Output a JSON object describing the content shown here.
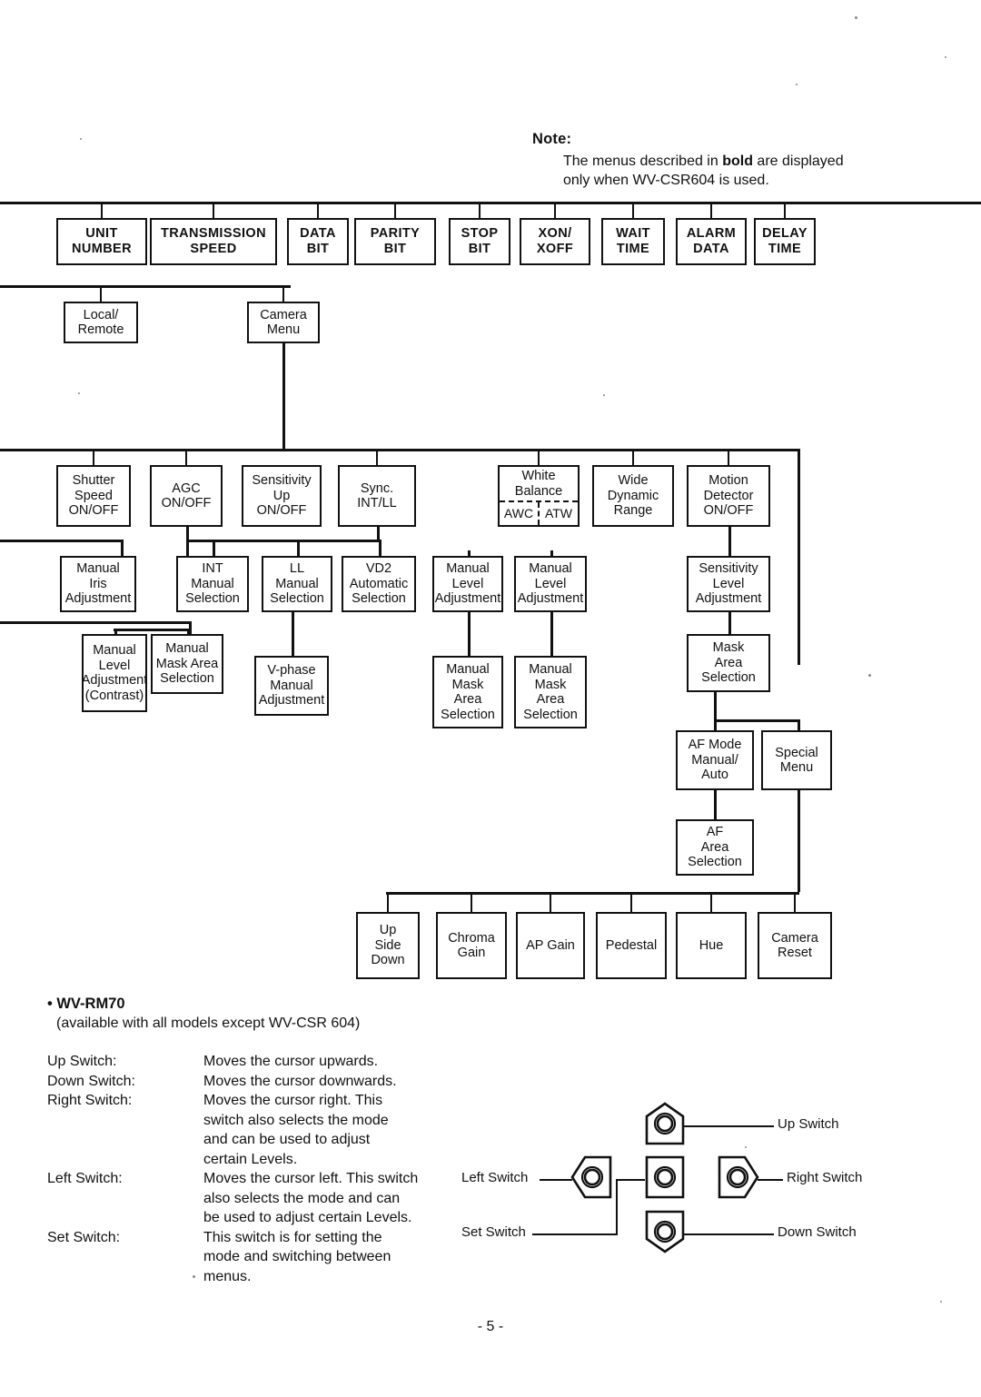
{
  "note": {
    "title": "Note:",
    "line1_pre": "The menus described in ",
    "line1_bold": "bold",
    "line1_post": " are displayed",
    "line2": "only when WV-CSR604 is used."
  },
  "chart": {
    "type": "diagram",
    "title": "Camera system menu hierarchy",
    "row_communication": [
      {
        "id": "unit-number",
        "lines": [
          "UNIT",
          "NUMBER"
        ],
        "bold": true
      },
      {
        "id": "transmission-speed",
        "lines": [
          "TRANSMISSION",
          "SPEED"
        ],
        "bold": true
      },
      {
        "id": "data-bit",
        "lines": [
          "DATA",
          "BIT"
        ],
        "bold": true
      },
      {
        "id": "parity-bit",
        "lines": [
          "PARITY",
          "BIT"
        ],
        "bold": true
      },
      {
        "id": "stop-bit",
        "lines": [
          "STOP",
          "BIT"
        ],
        "bold": true
      },
      {
        "id": "xon-xoff",
        "lines": [
          "XON/",
          "XOFF"
        ],
        "bold": true
      },
      {
        "id": "wait-time",
        "lines": [
          "WAIT",
          "TIME"
        ],
        "bold": true
      },
      {
        "id": "alarm-data",
        "lines": [
          "ALARM",
          "DATA"
        ],
        "bold": true
      },
      {
        "id": "delay-time",
        "lines": [
          "DELAY",
          "TIME"
        ],
        "bold": true
      }
    ],
    "row_mode": [
      {
        "id": "local-remote",
        "lines": [
          "Local/",
          "Remote"
        ]
      },
      {
        "id": "camera-menu",
        "lines": [
          "Camera",
          "Menu"
        ]
      }
    ],
    "row_camera_main": [
      {
        "id": "shutter-speed",
        "lines": [
          "Shutter",
          "Speed",
          "ON/OFF"
        ]
      },
      {
        "id": "agc",
        "lines": [
          "AGC",
          "ON/OFF"
        ]
      },
      {
        "id": "sensitivity-up",
        "lines": [
          "Sensitivity",
          "Up",
          "ON/OFF"
        ]
      },
      {
        "id": "sync",
        "lines": [
          "Sync.",
          "INT/LL"
        ]
      },
      {
        "id": "white-balance",
        "lines": [
          "White",
          "Balance"
        ],
        "split": [
          "AWC",
          "ATW"
        ]
      },
      {
        "id": "wide-dynamic-range",
        "lines": [
          "Wide",
          "Dynamic",
          "Range"
        ]
      },
      {
        "id": "motion-detector",
        "lines": [
          "Motion",
          "Detector",
          "ON/OFF"
        ]
      }
    ],
    "row_sub1": [
      {
        "id": "manual-iris-adjustment",
        "lines": [
          "Manual",
          "Iris",
          "Adjustment"
        ]
      },
      {
        "id": "int-manual-selection",
        "lines": [
          "INT",
          "Manual",
          "Selection"
        ]
      },
      {
        "id": "ll-manual-selection",
        "lines": [
          "LL",
          "Manual",
          "Selection"
        ]
      },
      {
        "id": "vd2-automatic-selection",
        "lines": [
          "VD2",
          "Automatic",
          "Selection"
        ]
      },
      {
        "id": "awc-manual-level",
        "lines": [
          "Manual",
          "Level",
          "Adjustment"
        ]
      },
      {
        "id": "atw-manual-level",
        "lines": [
          "Manual",
          "Level",
          "Adjustment"
        ]
      },
      {
        "id": "sensitivity-level",
        "lines": [
          "Sensitivity",
          "Level",
          "Adjustment"
        ]
      }
    ],
    "row_sub2": [
      {
        "id": "manual-level-contrast",
        "lines": [
          "Manual",
          "Level",
          "Adjustment",
          "(Contrast)"
        ]
      },
      {
        "id": "manual-mask-area",
        "lines": [
          "Manual",
          "Mask Area",
          "Selection"
        ]
      },
      {
        "id": "v-phase-manual",
        "lines": [
          "V-phase",
          "Manual",
          "Adjustment"
        ]
      },
      {
        "id": "awc-manual-mask-area",
        "lines": [
          "Manual",
          "Mask",
          "Area",
          "Selection"
        ]
      },
      {
        "id": "atw-manual-mask-area",
        "lines": [
          "Manual",
          "Mask",
          "Area",
          "Selection"
        ]
      },
      {
        "id": "md-mask-area",
        "lines": [
          "Mask",
          "Area",
          "Selection"
        ]
      }
    ],
    "row_af": [
      {
        "id": "af-mode",
        "lines": [
          "AF Mode",
          "Manual/",
          "Auto"
        ]
      },
      {
        "id": "special-menu",
        "lines": [
          "Special",
          "Menu"
        ]
      },
      {
        "id": "af-area",
        "lines": [
          "AF",
          "Area",
          "Selection"
        ]
      }
    ],
    "row_special": [
      {
        "id": "up-side-down",
        "lines": [
          "Up",
          "Side",
          "Down"
        ]
      },
      {
        "id": "chroma-gain",
        "lines": [
          "Chroma",
          "Gain"
        ]
      },
      {
        "id": "ap-gain",
        "lines": [
          "AP Gain"
        ]
      },
      {
        "id": "pedestal",
        "lines": [
          "Pedestal"
        ]
      },
      {
        "id": "hue",
        "lines": [
          "Hue"
        ]
      },
      {
        "id": "camera-reset",
        "lines": [
          "Camera",
          "Reset"
        ]
      }
    ]
  },
  "rm70": {
    "title": "• WV-RM70",
    "subtitle": "(available with all models except WV-CSR 604)",
    "switches": [
      {
        "name": "Up Switch:",
        "desc": [
          "Moves the cursor upwards."
        ]
      },
      {
        "name": "Down Switch:",
        "desc": [
          "Moves the cursor downwards."
        ]
      },
      {
        "name": "Right Switch:",
        "desc": [
          "Moves the cursor right. This",
          "switch also selects the mode",
          "and can be used to adjust",
          "certain Levels."
        ]
      },
      {
        "name": "Left Switch:",
        "desc": [
          "Moves the cursor left. This switch",
          "also selects the mode and can",
          "be used to adjust certain Levels."
        ]
      },
      {
        "name": "Set Switch:",
        "desc": [
          "This switch is for setting the",
          "mode and switching between",
          "menus."
        ]
      }
    ]
  },
  "switch_figure": {
    "labels": {
      "up": "Up Switch",
      "down": "Down Switch",
      "left": "Left Switch",
      "right": "Right Switch",
      "set": "Set Switch"
    }
  },
  "footer": {
    "page": "- 5 -"
  }
}
